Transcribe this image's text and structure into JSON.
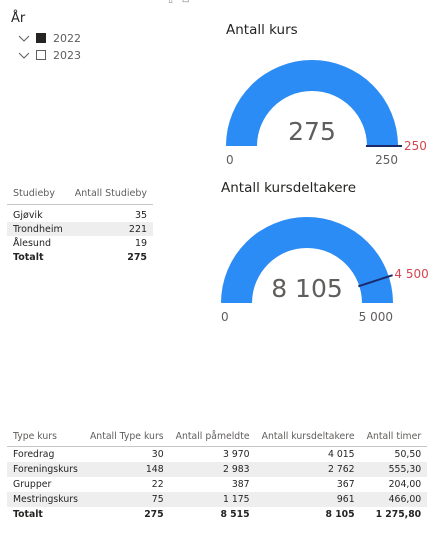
{
  "toolbar": {
    "glyphs": "▯ ⊡ ⋯"
  },
  "slicer": {
    "title": "År",
    "items": [
      {
        "label": "2022",
        "checked": true
      },
      {
        "label": "2023",
        "checked": false
      }
    ]
  },
  "studieby_table": {
    "headers": [
      "Studieby",
      "Antall Studieby"
    ],
    "rows": [
      {
        "city": "Gjøvik",
        "count": "35"
      },
      {
        "city": "Trondheim",
        "count": "221"
      },
      {
        "city": "Ålesund",
        "count": "19"
      }
    ],
    "total": {
      "label": "Totalt",
      "count": "275"
    }
  },
  "gauges": {
    "kurs": {
      "title": "Antall kurs",
      "value_label": "275",
      "min_label": "0",
      "max_label": "250",
      "target_label": "250"
    },
    "deltakere": {
      "title": "Antall kursdeltakere",
      "value_label": "8 105",
      "min_label": "0",
      "max_label": "5 000",
      "target_label": "4 500"
    }
  },
  "kurs_table": {
    "headers": [
      "Type kurs",
      "Antall Type kurs",
      "Antall påmeldte",
      "Antall kursdeltakere",
      "Antall timer"
    ],
    "rows": [
      [
        "Foredrag",
        "30",
        "3 970",
        "4 015",
        "50,50"
      ],
      [
        "Foreningskurs",
        "148",
        "2 983",
        "2 762",
        "555,30"
      ],
      [
        "Grupper",
        "22",
        "387",
        "367",
        "204,00"
      ],
      [
        "Mestringskurs",
        "75",
        "1 175",
        "961",
        "466,00"
      ]
    ],
    "total": [
      "Totalt",
      "275",
      "8 515",
      "8 105",
      "1 275,80"
    ]
  },
  "chart_data": [
    {
      "type": "gauge",
      "title": "Antall kurs",
      "value": 275,
      "min": 0,
      "max": 250,
      "target": 250,
      "colors": {
        "fill": "#2b8cf6",
        "target_line": "#1b2a6b",
        "target_label": "#d64550"
      }
    },
    {
      "type": "gauge",
      "title": "Antall kursdeltakere",
      "value": 8105,
      "min": 0,
      "max": 5000,
      "target": 4500,
      "colors": {
        "fill": "#2b8cf6",
        "target_line": "#1b2a6b",
        "target_label": "#d64550"
      }
    }
  ],
  "colors": {
    "accent": "#2b8cf6",
    "target_label": "#d64550",
    "row_band": "#eeeeee",
    "text": "#252423",
    "muted": "#605e5c"
  }
}
